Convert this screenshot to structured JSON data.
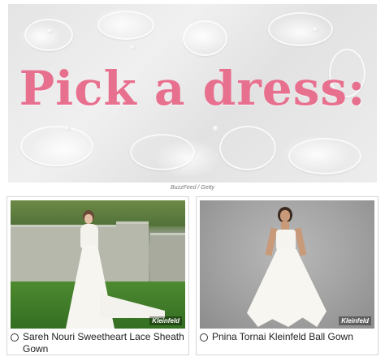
{
  "hero": {
    "title": "Pick a dress:",
    "credit": "BuzzFeed / Getty"
  },
  "options": [
    {
      "label": "Sareh Nouri Sweetheart Lace Sheath Gown",
      "watermark": "Kleinfeld",
      "selected": false
    },
    {
      "label": "Pnina Tornai Kleinfeld Ball Gown",
      "watermark": "Kleinfeld",
      "selected": false
    }
  ],
  "colors": {
    "title_pink": "#e8708f",
    "credit_gray": "#777777"
  }
}
